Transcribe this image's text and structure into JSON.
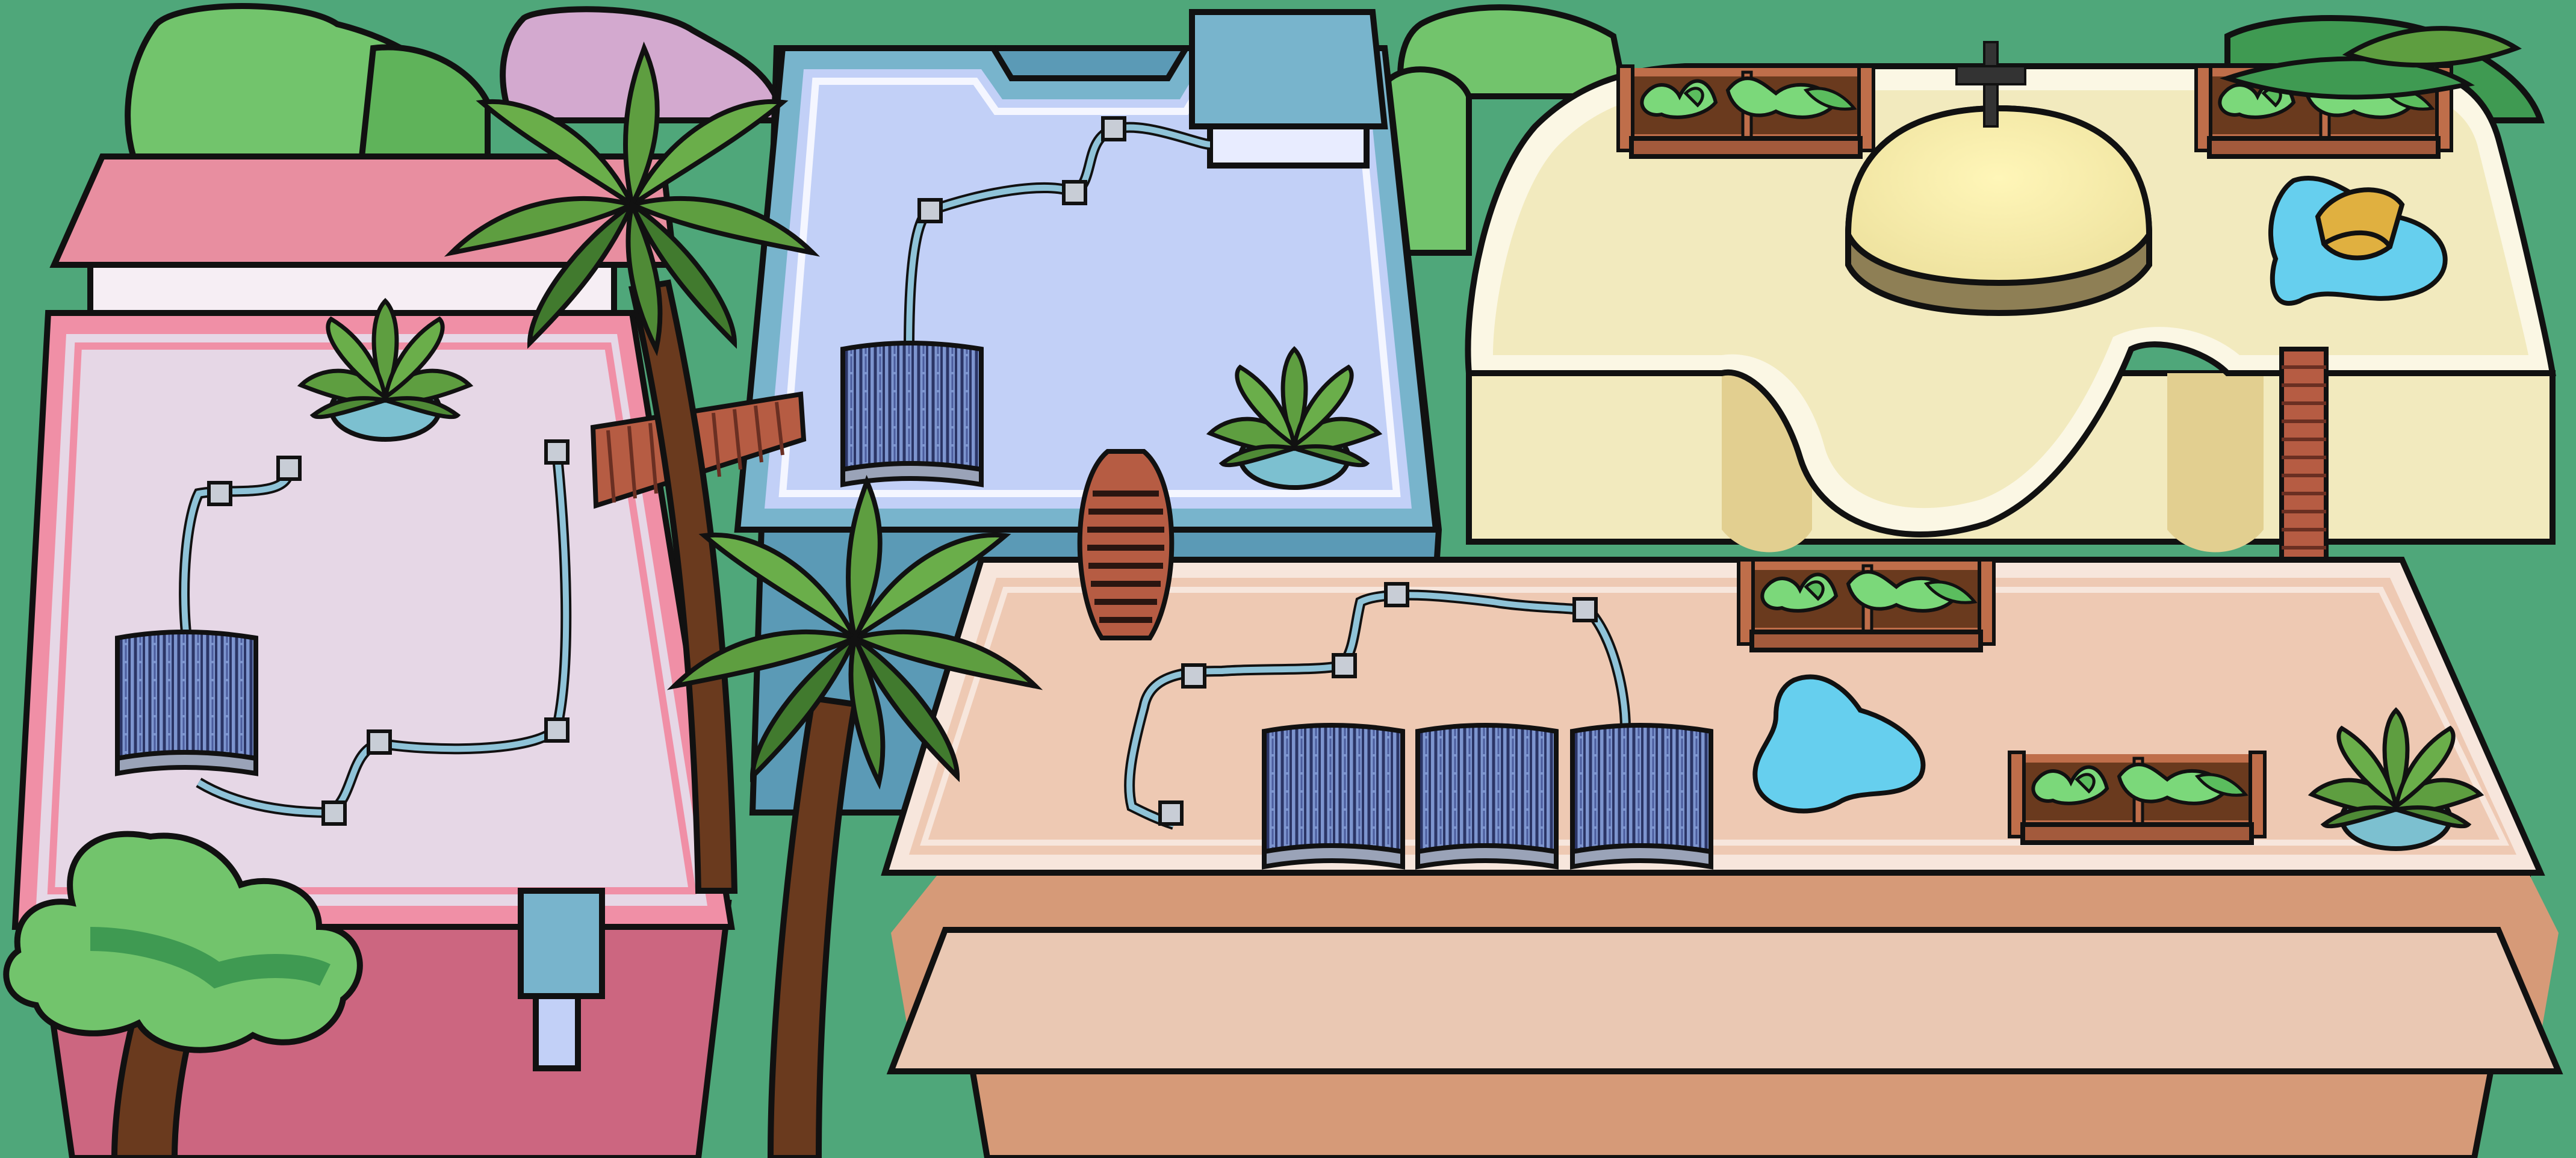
{
  "scene": {
    "kind": "isometric-rooftop-map",
    "buildings": [
      {
        "id": "pink-building",
        "roof_color": "#e6d7e6",
        "wall_color": "#cc6680",
        "trim_color": "#f08fa6"
      },
      {
        "id": "blue-building",
        "roof_color": "#c2d0f7",
        "wall_color": "#5b9ab6",
        "trim_color": "#78b4cc"
      },
      {
        "id": "tan-building",
        "roof_color": "#eec9b3",
        "wall_color": "#d69a78",
        "trim_color": "#f7e6dc"
      },
      {
        "id": "cream-building",
        "roof_color": "#f2eabe",
        "wall_color": "#e2cf90",
        "trim_color": "#fbf7e4"
      }
    ],
    "objects": [
      "solar-panel",
      "pipe",
      "potted-plant",
      "garden-planter",
      "puddle",
      "ladder",
      "palm-tree",
      "bush",
      "ventilation-duct",
      "skylight-dome",
      "cross-sign",
      "bucket"
    ],
    "colors": {
      "ground": "#4fa77a",
      "outline": "#111111",
      "bush_light": "#72c46c",
      "bush_dark": "#3f9a52",
      "palm_leaf": "#5e9e40",
      "palm_leaf_dark": "#417a2e",
      "trunk": "#6a3a1e",
      "solar_blue": "#7d95cf",
      "pipe": "#8fc3d8",
      "water": "#66cfee",
      "ladder": "#b65c43",
      "planter": "#bf6e4a",
      "vine": "#7bd87a"
    }
  }
}
